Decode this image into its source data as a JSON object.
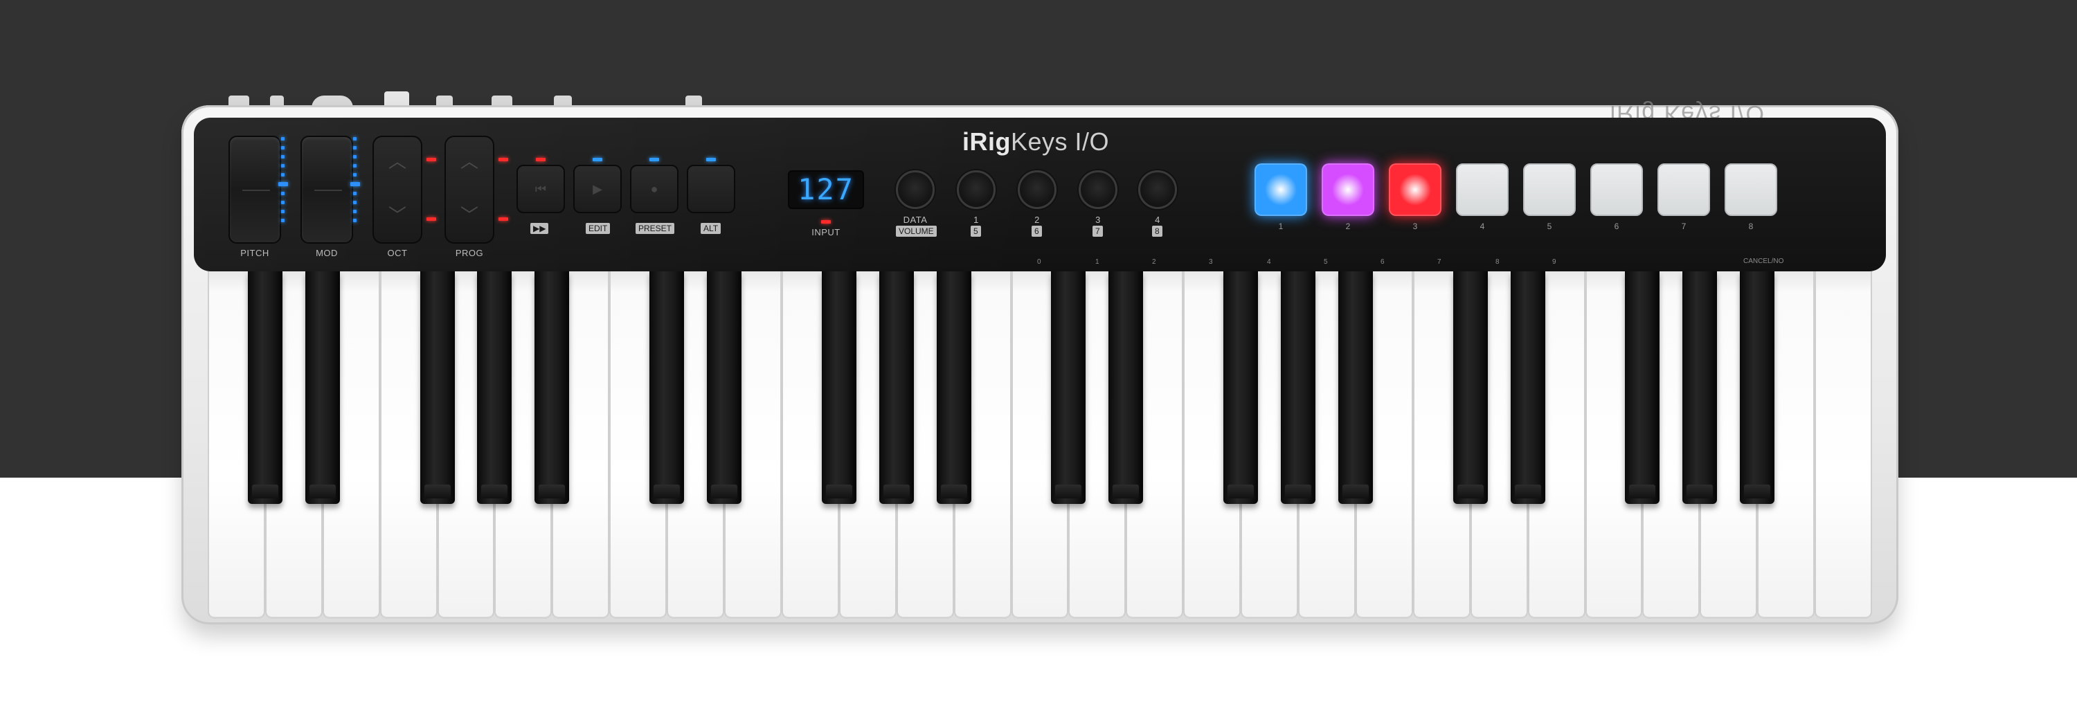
{
  "brand": {
    "prefix": "iRig",
    "suffix": "Keys I/O",
    "mirror": "iRig Keys I/O"
  },
  "controls": {
    "pitch_label": "PITCH",
    "mod_label": "MOD",
    "oct_label": "OCT",
    "prog_label": "PROG",
    "transport_label": "▶▶",
    "edit_label": "EDIT",
    "preset_label": "PRESET",
    "alt_label": "ALT",
    "input_label": "INPUT",
    "display_value": "127",
    "data_label": "DATA",
    "volume_label": "VOLUME"
  },
  "knobs": [
    {
      "top": "1",
      "sub": "5"
    },
    {
      "top": "2",
      "sub": "6"
    },
    {
      "top": "3",
      "sub": "7"
    },
    {
      "top": "4",
      "sub": "8"
    }
  ],
  "pads": [
    {
      "label": "1",
      "color": "#2f9dff",
      "lit": true
    },
    {
      "label": "2",
      "color": "#d64dff",
      "lit": true
    },
    {
      "label": "3",
      "color": "#ff2a36",
      "lit": true
    },
    {
      "label": "4",
      "color": "#e4e7e8",
      "lit": false
    },
    {
      "label": "5",
      "color": "#e4e7e8",
      "lit": false
    },
    {
      "label": "6",
      "color": "#e4e7e8",
      "lit": false
    },
    {
      "label": "7",
      "color": "#e4e7e8",
      "lit": false
    },
    {
      "label": "8",
      "color": "#e4e7e8",
      "lit": false
    }
  ],
  "key_ticks": [
    "0",
    "1",
    "2",
    "3",
    "4",
    "5",
    "6",
    "7",
    "8",
    "9"
  ],
  "cancel_label": "CANCEL/NO",
  "colors": {
    "led_blue": "#2e8fff",
    "led_red": "#ff2a2a",
    "background_dark": "#323232"
  }
}
